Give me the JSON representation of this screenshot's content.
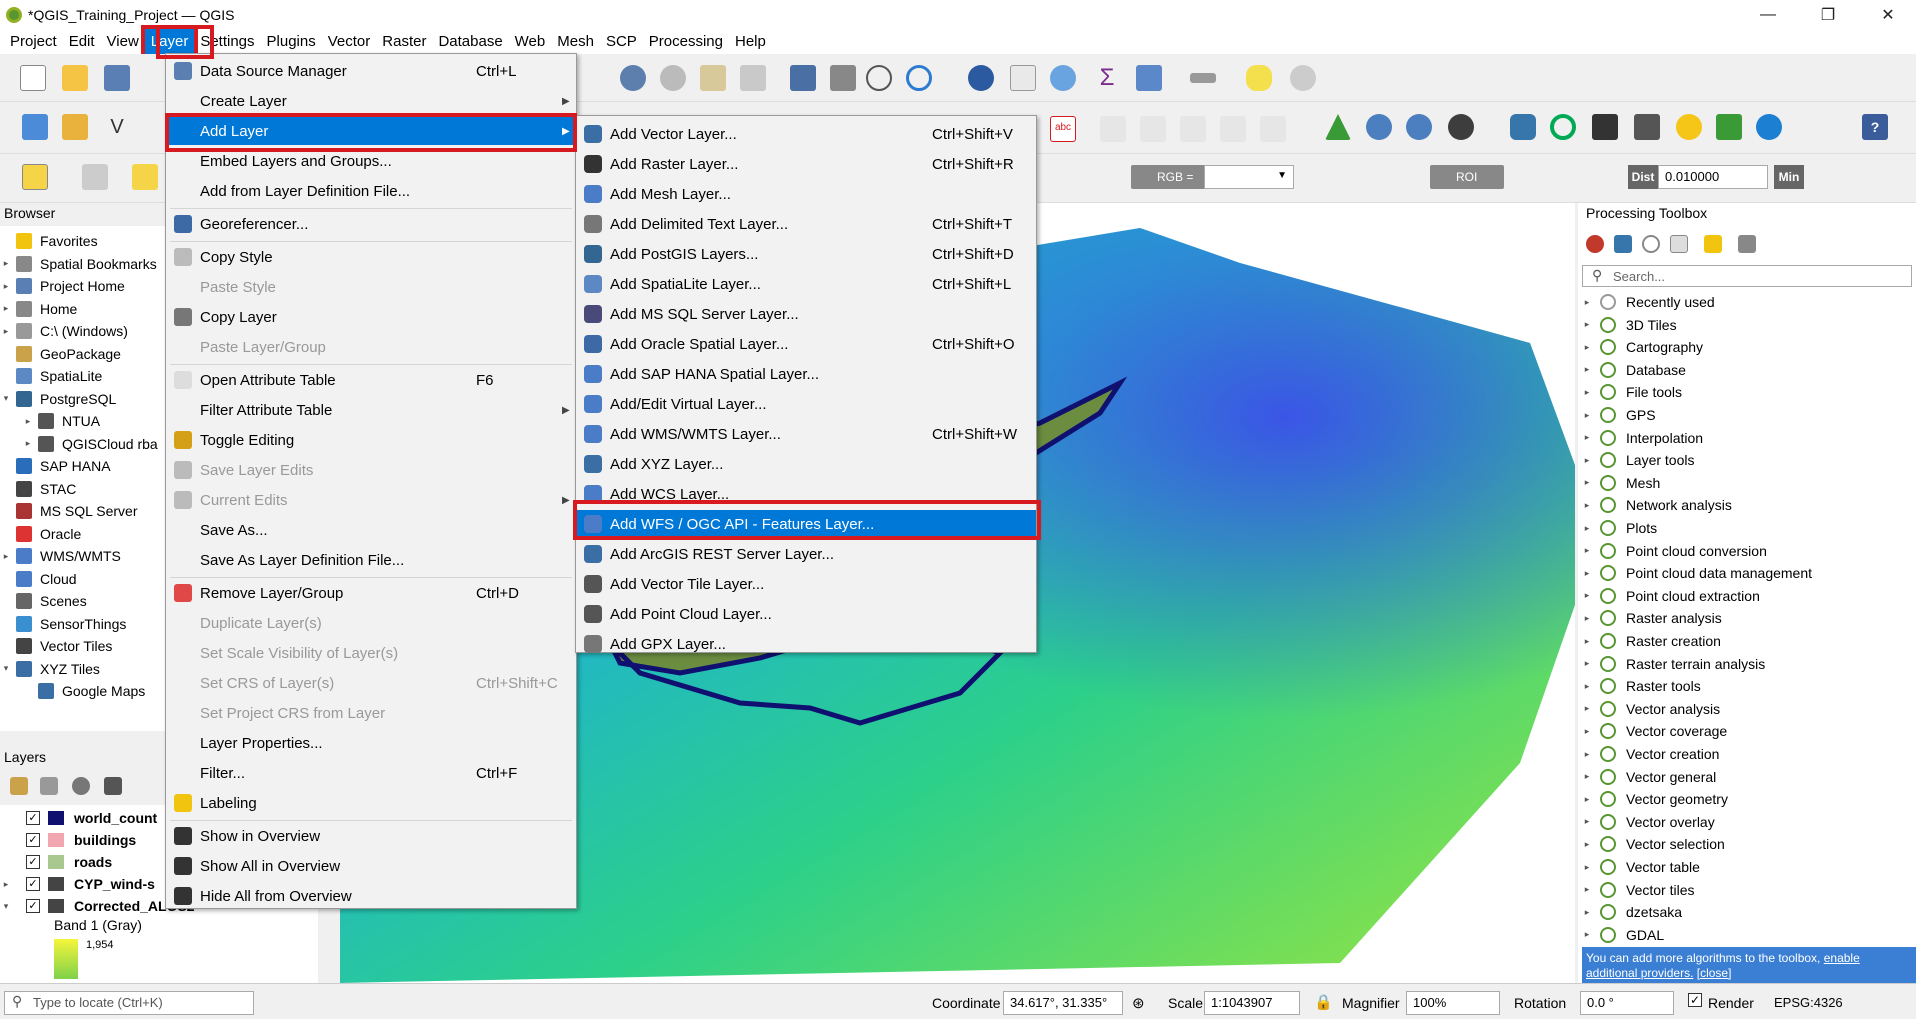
{
  "window": {
    "title": "*QGIS_Training_Project — QGIS",
    "min": "—",
    "max": "❐",
    "close": "✕"
  },
  "menubar": [
    "Project",
    "Edit",
    "View",
    "Layer",
    "Settings",
    "Plugins",
    "Vector",
    "Raster",
    "Database",
    "Web",
    "Mesh",
    "SCP",
    "Processing",
    "Help"
  ],
  "toolbar3": {
    "rgb_label": "RGB =",
    "roi_label": "ROI",
    "dist_label": "Dist",
    "dist_value": "0.010000",
    "min_label": "Min"
  },
  "browser": {
    "title": "Browser",
    "items": [
      {
        "label": "Favorites",
        "arrow": "",
        "indent": 0
      },
      {
        "label": "Spatial Bookmarks",
        "arrow": "▸",
        "indent": 0
      },
      {
        "label": "Project Home",
        "arrow": "▸",
        "indent": 0
      },
      {
        "label": "Home",
        "arrow": "▸",
        "indent": 0
      },
      {
        "label": "C:\\ (Windows)",
        "arrow": "▸",
        "indent": 0
      },
      {
        "label": "GeoPackage",
        "arrow": "",
        "indent": 0
      },
      {
        "label": "SpatiaLite",
        "arrow": "",
        "indent": 0
      },
      {
        "label": "PostgreSQL",
        "arrow": "▾",
        "indent": 0
      },
      {
        "label": "NTUA",
        "arrow": "▸",
        "indent": 1
      },
      {
        "label": "QGISCloud rba",
        "arrow": "▸",
        "indent": 1
      },
      {
        "label": "SAP HANA",
        "arrow": "",
        "indent": 0
      },
      {
        "label": "STAC",
        "arrow": "",
        "indent": 0
      },
      {
        "label": "MS SQL Server",
        "arrow": "",
        "indent": 0
      },
      {
        "label": "Oracle",
        "arrow": "",
        "indent": 0
      },
      {
        "label": "WMS/WMTS",
        "arrow": "▸",
        "indent": 0
      },
      {
        "label": "Cloud",
        "arrow": "",
        "indent": 0
      },
      {
        "label": "Scenes",
        "arrow": "",
        "indent": 0
      },
      {
        "label": "SensorThings",
        "arrow": "",
        "indent": 0
      },
      {
        "label": "Vector Tiles",
        "arrow": "",
        "indent": 0
      },
      {
        "label": "XYZ Tiles",
        "arrow": "▾",
        "indent": 0
      },
      {
        "label": "Google Maps",
        "arrow": "",
        "indent": 1
      }
    ]
  },
  "layers": {
    "title": "Layers",
    "items": [
      {
        "label": "world_count",
        "bold": true
      },
      {
        "label": "buildings",
        "bold": true
      },
      {
        "label": "roads",
        "bold": true
      },
      {
        "label": "CYP_wind-s",
        "bold": true
      },
      {
        "label": "Corrected_ALOS2",
        "bold": true
      }
    ],
    "band_label": "Band 1 (Gray)",
    "band_value": "1,954"
  },
  "layer_menu": [
    {
      "label": "Data Source Manager",
      "shortcut": "Ctrl+L",
      "disabled": false,
      "submenu": false
    },
    {
      "label": "Create Layer",
      "shortcut": "",
      "disabled": false,
      "submenu": true
    },
    {
      "label": "Add Layer",
      "shortcut": "",
      "disabled": false,
      "submenu": true,
      "highlight": true
    },
    {
      "label": "Embed Layers and Groups...",
      "shortcut": "",
      "disabled": false,
      "submenu": false
    },
    {
      "label": "Add from Layer Definition File...",
      "shortcut": "",
      "disabled": false,
      "submenu": false
    },
    {
      "label": "Georeferencer...",
      "shortcut": "",
      "disabled": false,
      "submenu": false
    },
    {
      "label": "Copy Style",
      "shortcut": "",
      "disabled": false,
      "submenu": false
    },
    {
      "label": "Paste Style",
      "shortcut": "",
      "disabled": true,
      "submenu": false
    },
    {
      "label": "Copy Layer",
      "shortcut": "",
      "disabled": false,
      "submenu": false
    },
    {
      "label": "Paste Layer/Group",
      "shortcut": "",
      "disabled": true,
      "submenu": false
    },
    {
      "label": "Open Attribute Table",
      "shortcut": "F6",
      "disabled": false,
      "submenu": false
    },
    {
      "label": "Filter Attribute Table",
      "shortcut": "",
      "disabled": false,
      "submenu": true
    },
    {
      "label": "Toggle Editing",
      "shortcut": "",
      "disabled": false,
      "submenu": false
    },
    {
      "label": "Save Layer Edits",
      "shortcut": "",
      "disabled": true,
      "submenu": false
    },
    {
      "label": "Current Edits",
      "shortcut": "",
      "disabled": true,
      "submenu": true
    },
    {
      "label": "Save As...",
      "shortcut": "",
      "disabled": false,
      "submenu": false
    },
    {
      "label": "Save As Layer Definition File...",
      "shortcut": "",
      "disabled": false,
      "submenu": false
    },
    {
      "label": "Remove Layer/Group",
      "shortcut": "Ctrl+D",
      "disabled": false,
      "submenu": false
    },
    {
      "label": "Duplicate Layer(s)",
      "shortcut": "",
      "disabled": true,
      "submenu": false
    },
    {
      "label": "Set Scale Visibility of Layer(s)",
      "shortcut": "",
      "disabled": true,
      "submenu": false
    },
    {
      "label": "Set CRS of Layer(s)",
      "shortcut": "Ctrl+Shift+C",
      "disabled": true,
      "submenu": false
    },
    {
      "label": "Set Project CRS from Layer",
      "shortcut": "",
      "disabled": true,
      "submenu": false
    },
    {
      "label": "Layer Properties...",
      "shortcut": "",
      "disabled": false,
      "submenu": false
    },
    {
      "label": "Filter...",
      "shortcut": "Ctrl+F",
      "disabled": false,
      "submenu": false
    },
    {
      "label": "Labeling",
      "shortcut": "",
      "disabled": false,
      "submenu": false
    },
    {
      "label": "Show in Overview",
      "shortcut": "",
      "disabled": false,
      "submenu": false
    },
    {
      "label": "Show All in Overview",
      "shortcut": "",
      "disabled": false,
      "submenu": false
    },
    {
      "label": "Hide All from Overview",
      "shortcut": "",
      "disabled": false,
      "submenu": false
    }
  ],
  "add_layer_menu": [
    {
      "label": "Add Vector Layer...",
      "shortcut": "Ctrl+Shift+V"
    },
    {
      "label": "Add Raster Layer...",
      "shortcut": "Ctrl+Shift+R"
    },
    {
      "label": "Add Mesh Layer...",
      "shortcut": ""
    },
    {
      "label": "Add Delimited Text Layer...",
      "shortcut": "Ctrl+Shift+T"
    },
    {
      "label": "Add PostGIS Layers...",
      "shortcut": "Ctrl+Shift+D"
    },
    {
      "label": "Add SpatiaLite Layer...",
      "shortcut": "Ctrl+Shift+L"
    },
    {
      "label": "Add MS SQL Server Layer...",
      "shortcut": ""
    },
    {
      "label": "Add Oracle Spatial Layer...",
      "shortcut": "Ctrl+Shift+O"
    },
    {
      "label": "Add SAP HANA Spatial Layer...",
      "shortcut": ""
    },
    {
      "label": "Add/Edit Virtual Layer...",
      "shortcut": ""
    },
    {
      "label": "Add WMS/WMTS Layer...",
      "shortcut": "Ctrl+Shift+W"
    },
    {
      "label": "Add XYZ Layer...",
      "shortcut": ""
    },
    {
      "label": "Add WCS Layer...",
      "shortcut": ""
    },
    {
      "label": "Add WFS / OGC API - Features Layer...",
      "shortcut": "",
      "highlight": true
    },
    {
      "label": "Add ArcGIS REST Server Layer...",
      "shortcut": ""
    },
    {
      "label": "Add Vector Tile Layer...",
      "shortcut": ""
    },
    {
      "label": "Add Point Cloud Layer...",
      "shortcut": ""
    },
    {
      "label": "Add GPX Layer...",
      "shortcut": ""
    }
  ],
  "toolbox": {
    "title": "Processing Toolbox",
    "search_placeholder": "Search...",
    "items": [
      "Recently used",
      "3D Tiles",
      "Cartography",
      "Database",
      "File tools",
      "GPS",
      "Interpolation",
      "Layer tools",
      "Mesh",
      "Network analysis",
      "Plots",
      "Point cloud conversion",
      "Point cloud data management",
      "Point cloud extraction",
      "Raster analysis",
      "Raster creation",
      "Raster terrain analysis",
      "Raster tools",
      "Vector analysis",
      "Vector coverage",
      "Vector creation",
      "Vector general",
      "Vector geometry",
      "Vector overlay",
      "Vector selection",
      "Vector table",
      "Vector tiles",
      "dzetsaka",
      "GDAL"
    ],
    "info": "You can add more algorithms to the toolbox,",
    "info_link": "enable additional providers.",
    "info_close": "[close]"
  },
  "status": {
    "locate_placeholder": "Type to locate (Ctrl+K)",
    "coordinate_label": "Coordinate",
    "coordinate_value": "34.617°, 31.335°",
    "scale_label": "Scale",
    "scale_value": "1:1043907",
    "magnifier_label": "Magnifier",
    "magnifier_value": "100%",
    "rotation_label": "Rotation",
    "rotation_value": "0.0 °",
    "render_label": "Render",
    "crs": "EPSG:4326"
  },
  "colors": {
    "highlight": "#0078d7",
    "annotation": "#d71920",
    "qgis_green": "#589632"
  }
}
